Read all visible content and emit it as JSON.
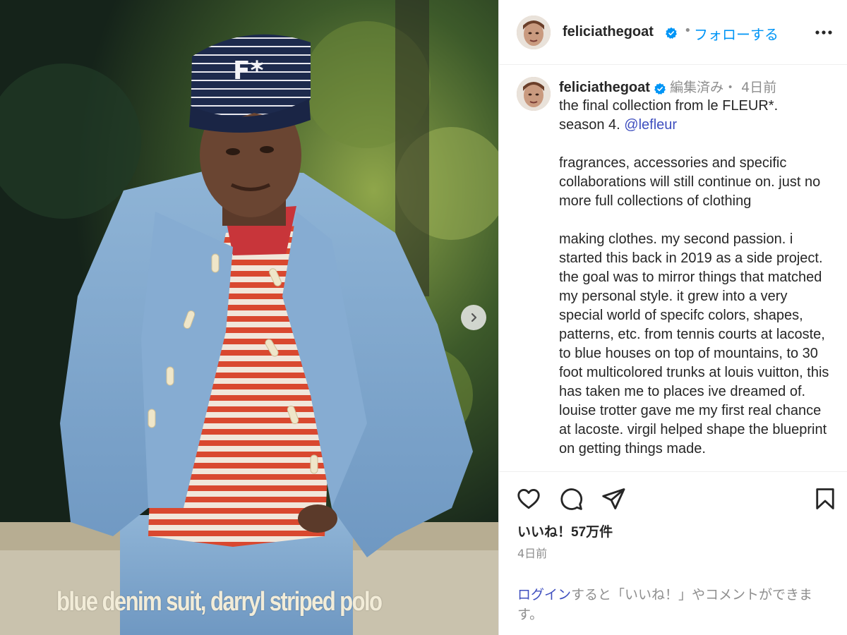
{
  "media": {
    "caption": "blue denim suit, darryl striped polo",
    "next_icon": "chevron-right-icon"
  },
  "header": {
    "username": "feliciathegoat",
    "dot": "•",
    "follow_label": "フォローする",
    "more_icon": "more-horizontal-icon"
  },
  "post": {
    "username": "feliciathegoat",
    "meta": "編集済み・ 4日前",
    "line1": "the final collection from le FLEUR*.",
    "line2_prefix": "season 4. ",
    "mention": "@lefleur",
    "paragraph2": "fragrances, accessories and specific collaborations will still continue on. just no more full collections of clothing",
    "paragraph3": "making clothes. my second passion. i started this back in 2019 as a side project. the goal was to mirror things that matched my personal style. it grew into a very special world of specifc colors, shapes, patterns, etc. from tennis courts at lacoste, to blue houses on top of mountains, to 30 foot multicolored trunks at louis vuitton, this has taken me to places ive dreamed of. louise trotter gave me my first real chance at lacoste. virgil helped shape the blueprint on getting things made."
  },
  "actions": {
    "icons": [
      "heart-icon",
      "comment-icon",
      "share-icon",
      "bookmark-icon"
    ],
    "likes": "いいね！57万件",
    "date": "4日前",
    "login_link": "ログイン",
    "login_rest": "すると「いいね！」やコメントができます。"
  },
  "colors": {
    "accent": "#0095f6",
    "link": "#3f4fbf",
    "muted": "#8e8e8e",
    "text": "#262626",
    "verified": "#0095f6"
  }
}
